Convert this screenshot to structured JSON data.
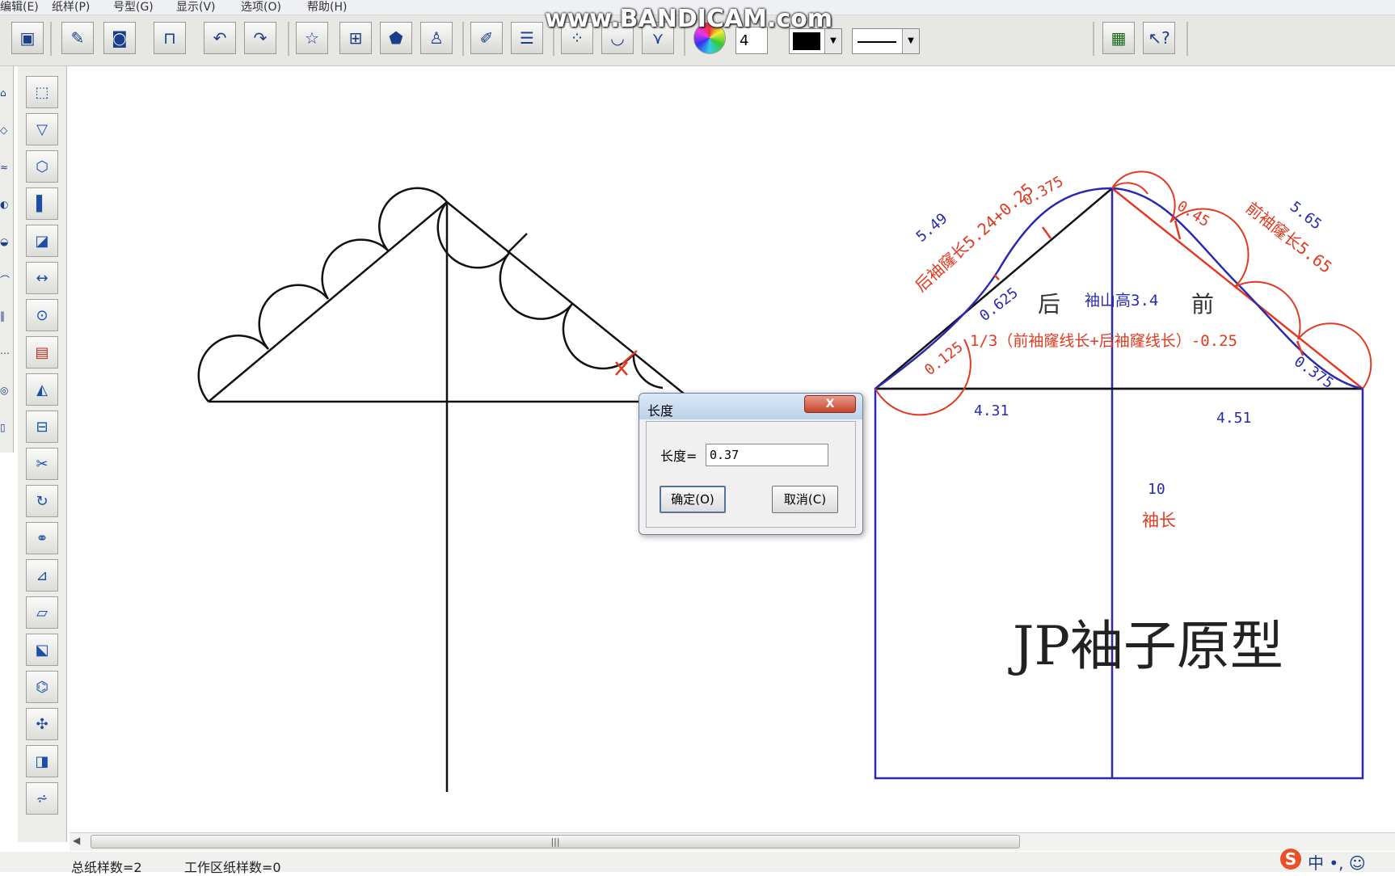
{
  "menu": [
    "编辑(E)",
    "纸样(P)",
    "号型(G)",
    "显示(V)",
    "选项(O)",
    "帮助(H)"
  ],
  "watermark": "www.BANDICAM.com",
  "toolbar": {
    "line_width": "4",
    "color": "#000000"
  },
  "toolbar_icons": [
    "save-icon",
    "pen-tool-icon",
    "camera-icon",
    "table-icon",
    "undo-icon",
    "redo-icon",
    "grading-icon",
    "grid-icon",
    "shield-piece-icon",
    "lock-user-icon",
    "brush-icon",
    "layout-icon",
    "dots-icon",
    "curve-icon",
    "dart-icon",
    "color-wheel-icon",
    "film-icon",
    "help-pointer-icon"
  ],
  "left_tools": [
    "select-icon",
    "pocket-icon",
    "seam-icon",
    "piece-icon",
    "measure-icon",
    "ruler-icon",
    "button-icon",
    "pleat-icon",
    "dart-tool-icon",
    "mirror-icon",
    "cut-icon",
    "rotate-icon",
    "split-icon",
    "align-icon",
    "rect-icon",
    "fold-icon",
    "transform-icon",
    "merge-icon",
    "mark-icon",
    "hem-icon"
  ],
  "drawing": {
    "labels": {
      "back_len": "5.49",
      "back_formula": "后袖窿长5.24+0.25",
      "back_offset": "0.375",
      "front_offset": "0.45",
      "front_label": "前袖窿长5.65",
      "front_len": "5.65",
      "back_mid": "0.625",
      "back_low": "0.125",
      "front_low": "0.375",
      "back": "后",
      "cap_height": "袖山高3.4",
      "front": "前",
      "formula": "1/3（前袖窿线长+后袖窿线长）-0.25",
      "back_width": "4.31",
      "front_width": "4.51",
      "sleeve_len_val": "10",
      "sleeve_len": "袖长",
      "title": "JP袖子原型"
    }
  },
  "dialog": {
    "title": "长度",
    "close": "X",
    "label": "长度=",
    "value": "0.37",
    "ok": "确定(O)",
    "cancel": "取消(C)"
  },
  "status": {
    "total": "总纸样数=2",
    "workspace": "工作区纸样数=0"
  },
  "ime": {
    "logo": "S",
    "text": "中 •, ☺"
  },
  "colors": {
    "red": "#e03a22",
    "blue": "#2a2ab0",
    "black": "#111111"
  }
}
